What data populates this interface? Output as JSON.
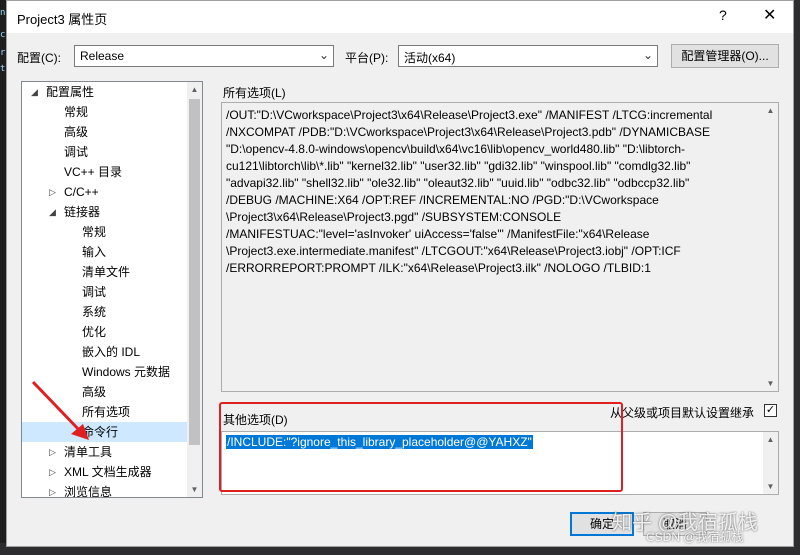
{
  "window": {
    "title": "Project3 属性页",
    "help_glyph": "?",
    "close_glyph": "✕"
  },
  "config": {
    "label": "配置(C):",
    "value": "Release",
    "platform_label": "平台(P):",
    "platform_value": "活动(x64)",
    "manager_button": "配置管理器(O)..."
  },
  "tree": {
    "items": [
      {
        "label": "配置属性",
        "level": 0,
        "exp": "◢"
      },
      {
        "label": "常规",
        "level": 1,
        "exp": ""
      },
      {
        "label": "高级",
        "level": 1,
        "exp": ""
      },
      {
        "label": "调试",
        "level": 1,
        "exp": ""
      },
      {
        "label": "VC++ 目录",
        "level": 1,
        "exp": ""
      },
      {
        "label": "C/C++",
        "level": 1,
        "exp": "▷"
      },
      {
        "label": "链接器",
        "level": 1,
        "exp": "◢"
      },
      {
        "label": "常规",
        "level": 2,
        "exp": ""
      },
      {
        "label": "输入",
        "level": 2,
        "exp": ""
      },
      {
        "label": "清单文件",
        "level": 2,
        "exp": ""
      },
      {
        "label": "调试",
        "level": 2,
        "exp": ""
      },
      {
        "label": "系统",
        "level": 2,
        "exp": ""
      },
      {
        "label": "优化",
        "level": 2,
        "exp": ""
      },
      {
        "label": "嵌入的 IDL",
        "level": 2,
        "exp": ""
      },
      {
        "label": "Windows 元数据",
        "level": 2,
        "exp": ""
      },
      {
        "label": "高级",
        "level": 2,
        "exp": ""
      },
      {
        "label": "所有选项",
        "level": 2,
        "exp": ""
      },
      {
        "label": "命令行",
        "level": 2,
        "exp": "",
        "selected": true
      },
      {
        "label": "清单工具",
        "level": 1,
        "exp": "▷"
      },
      {
        "label": "XML 文档生成器",
        "level": 1,
        "exp": "▷"
      },
      {
        "label": "浏览信息",
        "level": 1,
        "exp": "▷"
      }
    ]
  },
  "all_options": {
    "label": "所有选项(L)",
    "lines": [
      "/OUT:\"D:\\VCworkspace\\Project3\\x64\\Release\\Project3.exe\" /MANIFEST /LTCG:incremental",
      "/NXCOMPAT /PDB:\"D:\\VCworkspace\\Project3\\x64\\Release\\Project3.pdb\" /DYNAMICBASE",
      "\"D:\\opencv-4.8.0-windows\\opencv\\build\\x64\\vc16\\lib\\opencv_world480.lib\" \"D:\\libtorch-",
      "cu121\\libtorch\\lib\\*.lib\" \"kernel32.lib\" \"user32.lib\" \"gdi32.lib\" \"winspool.lib\" \"comdlg32.lib\"",
      "\"advapi32.lib\" \"shell32.lib\" \"ole32.lib\" \"oleaut32.lib\" \"uuid.lib\" \"odbc32.lib\" \"odbccp32.lib\"",
      "/DEBUG /MACHINE:X64 /OPT:REF /INCREMENTAL:NO /PGD:\"D:\\VCworkspace",
      "\\Project3\\x64\\Release\\Project3.pgd\" /SUBSYSTEM:CONSOLE",
      "/MANIFESTUAC:\"level='asInvoker' uiAccess='false'\" /ManifestFile:\"x64\\Release",
      "\\Project3.exe.intermediate.manifest\" /LTCGOUT:\"x64\\Release\\Project3.iobj\" /OPT:ICF",
      "/ERRORREPORT:PROMPT /ILK:\"x64\\Release\\Project3.ilk\" /NOLOGO /TLBID:1"
    ]
  },
  "other_options": {
    "label": "其他选项(D)",
    "inherit_label": "从父级或项目默认设置继承",
    "inherit_checked": "✓",
    "value": "/INCLUDE:\"?ignore_this_library_placeholder@@YAHXZ\""
  },
  "buttons": {
    "ok": "确定",
    "cancel": "取消"
  },
  "watermark": {
    "main": "知乎 @我宿孤栈",
    "sub": "CSDN @我宿孤栈"
  },
  "colors": {
    "selection": "#0078d7",
    "highlight": "#e02020"
  }
}
